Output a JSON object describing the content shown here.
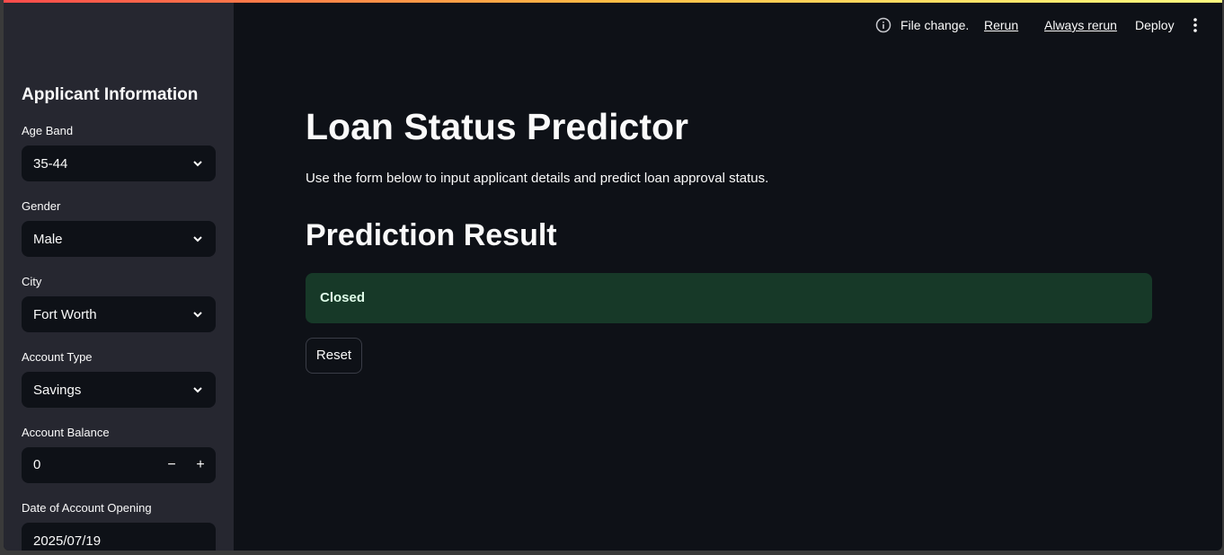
{
  "header": {
    "status_text": "File change.",
    "rerun_label": "Rerun",
    "always_rerun_label": "Always rerun",
    "deploy_label": "Deploy",
    "icons": {
      "status": "info-icon",
      "menu": "kebab-menu-icon"
    }
  },
  "sidebar": {
    "title": "Applicant Information",
    "fields": {
      "age_band": {
        "label": "Age Band",
        "value": "35-44"
      },
      "gender": {
        "label": "Gender",
        "value": "Male"
      },
      "city": {
        "label": "City",
        "value": "Fort Worth"
      },
      "account_type": {
        "label": "Account Type",
        "value": "Savings"
      },
      "account_balance": {
        "label": "Account Balance",
        "value": "0",
        "decrement": "−",
        "increment": "+"
      },
      "opening_date": {
        "label": "Date of Account Opening",
        "value": "2025/07/19"
      }
    }
  },
  "main": {
    "title": "Loan Status Predictor",
    "description": "Use the form below to input applicant details and predict loan approval status.",
    "result_heading": "Prediction Result",
    "result_value": "Closed",
    "reset_label": "Reset"
  },
  "colors": {
    "background": "#0e1117",
    "sidebar": "#262730",
    "success_bg": "#173928",
    "success_text": "#dffde9",
    "accent_gradient_start": "#ff4b4b",
    "accent_gradient_end": "#fffd80"
  }
}
